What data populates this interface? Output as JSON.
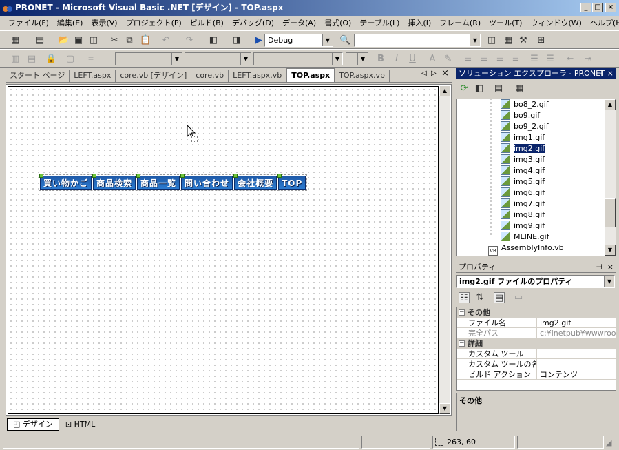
{
  "window": {
    "title": "PRONET - Microsoft Visual Basic .NET [デザイン] - TOP.aspx",
    "min_label": "_",
    "max_label": "□",
    "close_label": "×"
  },
  "menubar": {
    "items": [
      "ファイル(F)",
      "編集(E)",
      "表示(V)",
      "プロジェクト(P)",
      "ビルド(B)",
      "デバッグ(D)",
      "データ(A)",
      "書式(O)",
      "テーブル(L)",
      "挿入(I)",
      "フレーム(R)",
      "ツール(T)",
      "ウィンドウ(W)",
      "ヘルプ(H)"
    ]
  },
  "toolbar": {
    "config_value": "Debug",
    "find_value": ""
  },
  "doc_tabs": {
    "items": [
      "スタート ページ",
      "LEFT.aspx",
      "core.vb [デザイン]",
      "core.vb",
      "LEFT.aspx.vb",
      "TOP.aspx",
      "TOP.aspx.vb"
    ],
    "active": "TOP.aspx"
  },
  "designer": {
    "nav_images": [
      "買い物かご",
      "商品検索",
      "商品一覧",
      "問い合わせ",
      "会社概要",
      "TOP"
    ]
  },
  "view_tabs": {
    "design": "デザイン",
    "html": "HTML"
  },
  "solution_explorer": {
    "title": "ソリューション エクスプローラ - PRONET",
    "items": [
      "bo8_2.gif",
      "bo9.gif",
      "bo9_2.gif",
      "img1.gif",
      "img2.gif",
      "img3.gif",
      "img4.gif",
      "img5.gif",
      "img6.gif",
      "img7.gif",
      "img8.gif",
      "img9.gif",
      "MLINE.gif",
      "AssemblyInfo.vb"
    ],
    "selected": "img2.gif"
  },
  "properties": {
    "title": "プロパティ",
    "object_selector": "img2.gif ファイルのプロパティ",
    "categories": [
      {
        "name": "その他",
        "rows": [
          {
            "name": "ファイル名",
            "value": "img2.gif"
          },
          {
            "name": "完全パス",
            "value": "c:¥inetpub¥wwwroot¥P"
          }
        ]
      },
      {
        "name": "詳細",
        "rows": [
          {
            "name": "カスタム ツール",
            "value": ""
          },
          {
            "name": "カスタム ツールの名前",
            "value": ""
          },
          {
            "name": "ビルド アクション",
            "value": "コンテンツ"
          }
        ]
      }
    ],
    "description_title": "その他"
  },
  "statusbar": {
    "message": "",
    "position": "263, 60"
  },
  "colors": {
    "title_gradient_start": "#0a246a",
    "title_gradient_end": "#a6caf0",
    "selection": "#0a246a",
    "chrome": "#d4d0c8"
  }
}
